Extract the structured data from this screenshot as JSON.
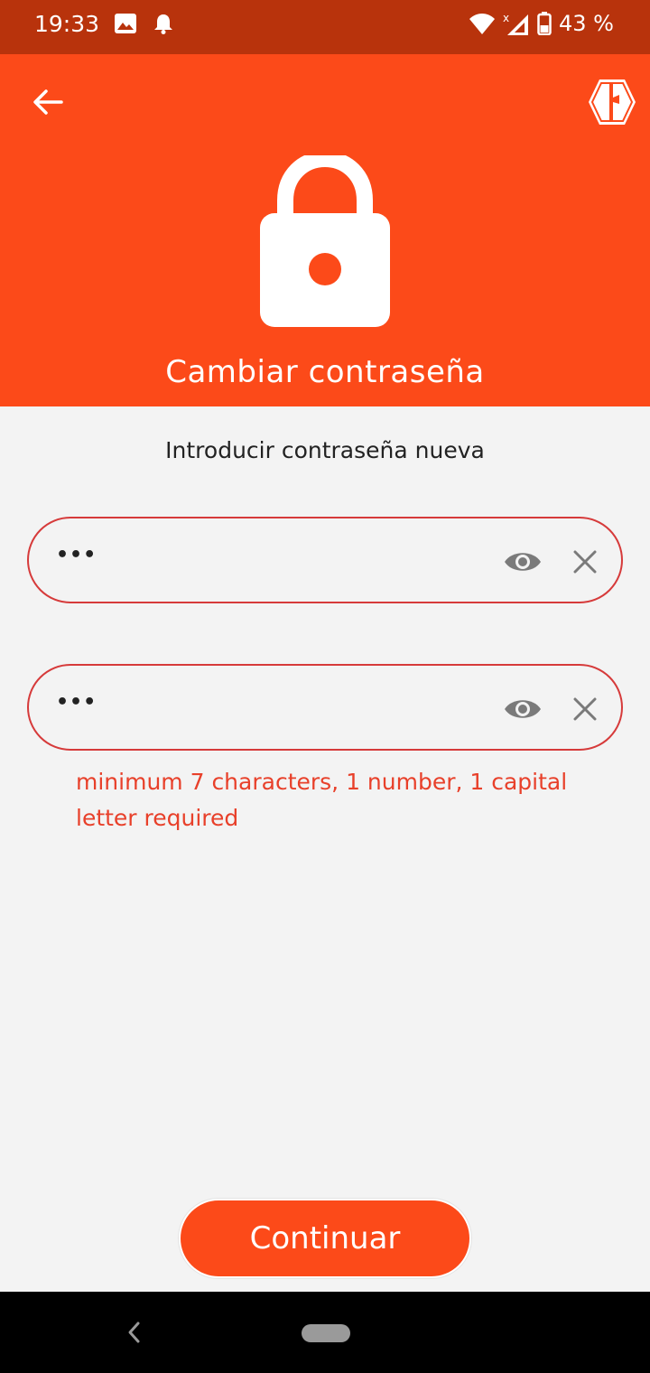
{
  "status_bar": {
    "time": "19:33",
    "battery": "43 %",
    "icons": [
      "image-icon",
      "bell-icon",
      "wifi-icon",
      "signal-icon",
      "battery-icon"
    ]
  },
  "header": {
    "title": "Cambiar contraseña",
    "icons": [
      "back-arrow-icon",
      "app-logo-icon",
      "lock-icon"
    ]
  },
  "form": {
    "subtitle": "Introducir contraseña nueva",
    "password_value": "•••",
    "confirm_value": "•••",
    "error": "minimum 7 characters, 1 number, 1 capital letter required"
  },
  "actions": {
    "continue_label": "Continuar"
  },
  "colors": {
    "primary": "#fc4a19",
    "status_bar": "#b8330c",
    "error": "#e8402a",
    "field_border": "#d63a3a",
    "background": "#f3f3f3"
  }
}
